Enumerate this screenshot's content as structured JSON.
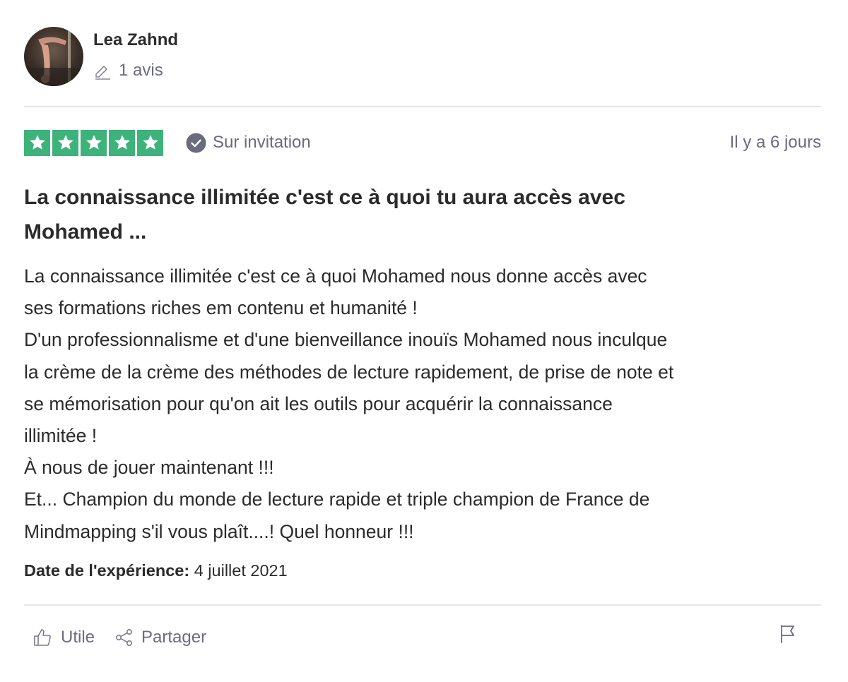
{
  "reviewer": {
    "name": "Lea Zahnd",
    "review_count": "1 avis"
  },
  "rating": {
    "stars": 5,
    "max_stars": 5,
    "star_color": "#3db37b",
    "verified_label": "Sur invitation",
    "date": "Il y a 6 jours"
  },
  "review": {
    "title_lines": [
      "La connaissance illimitée c'est ce à quoi tu aura accès avec",
      "Mohamed ..."
    ],
    "body_lines": [
      "La connaissance illimitée c'est ce à quoi Mohamed nous donne accès avec",
      "ses formations riches em contenu et humanité !",
      "D'un professionnalisme et d'une bienveillance inouïs Mohamed nous inculque",
      "la crème de la crème des méthodes de lecture rapidement, de prise de note et",
      "se mémorisation pour qu'on ait les outils pour acquérir la connaissance",
      "illimitée !",
      "À nous de jouer maintenant !!!",
      "Et... Champion du monde de lecture rapide et triple champion de France de",
      "Mindmapping s'il vous plaît....! Quel honneur !!!"
    ],
    "experience_label": "Date de l'expérience:",
    "experience_date": "4 juillet 2021"
  },
  "actions": {
    "useful_label": "Utile",
    "share_label": "Partager"
  },
  "icons": {
    "pen": "pen-icon",
    "verified": "check-circle-icon",
    "useful": "thumbs-up-icon",
    "share": "share-icon",
    "flag": "flag-icon"
  },
  "colors": {
    "text_muted": "#6b6b80",
    "divider": "#e5e5e5"
  }
}
